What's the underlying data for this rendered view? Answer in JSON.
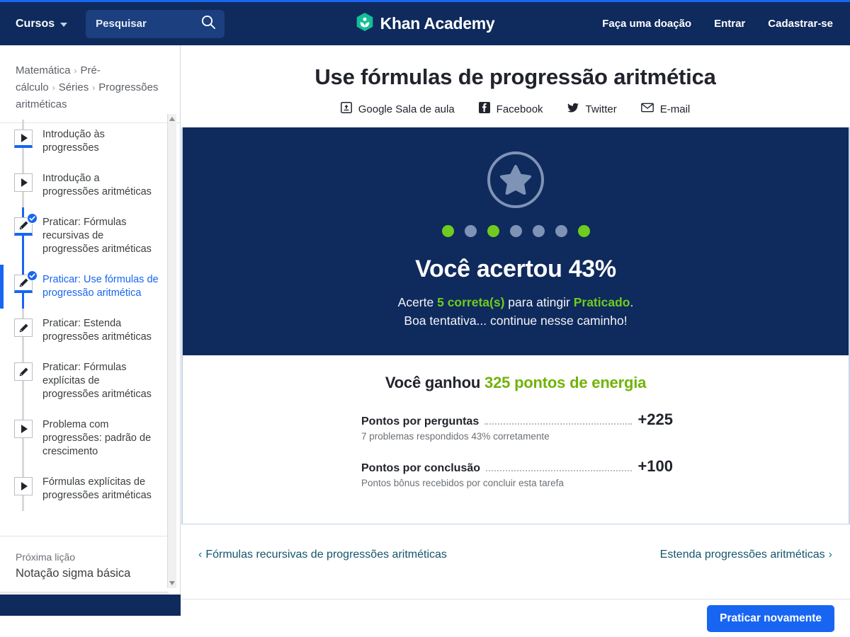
{
  "nav": {
    "courses_label": "Cursos",
    "search_placeholder": "Pesquisar",
    "brand": "Khan Academy",
    "donate": "Faça uma doação",
    "login": "Entrar",
    "signup": "Cadastrar-se"
  },
  "sidebar": {
    "breadcrumbs": [
      "Matemática",
      "Pré-cálculo",
      "Séries",
      "Progressões aritméticas"
    ],
    "lessons": [
      {
        "label": "Introdução às progressões",
        "type": "video",
        "state": "in-progress",
        "completed": false
      },
      {
        "label": "Introdução a progressões aritméticas",
        "type": "video",
        "state": "default",
        "completed": false
      },
      {
        "label": "Praticar: Fórmulas recursivas de progressões aritméticas",
        "type": "exercise",
        "state": "done",
        "completed": true
      },
      {
        "label": "Praticar: Use fórmulas de progressão aritmética",
        "type": "exercise",
        "state": "active",
        "completed": true
      },
      {
        "label": "Praticar: Estenda progressões aritméticas",
        "type": "exercise",
        "state": "default",
        "completed": false
      },
      {
        "label": "Praticar: Fórmulas explícitas de progressões aritméticas",
        "type": "exercise",
        "state": "default",
        "completed": false
      },
      {
        "label": "Problema com progressões: padrão de crescimento",
        "type": "video",
        "state": "default",
        "completed": false
      },
      {
        "label": "Fórmulas explícitas de progressões aritméticas",
        "type": "video",
        "state": "default",
        "completed": false
      }
    ],
    "next_lesson_label": "Próxima lição",
    "next_lesson_title": "Notação sigma básica"
  },
  "main": {
    "title": "Use fórmulas de progressão aritmética",
    "share": [
      {
        "label": "Google Sala de aula",
        "icon": "google-classroom-icon"
      },
      {
        "label": "Facebook",
        "icon": "facebook-icon"
      },
      {
        "label": "Twitter",
        "icon": "twitter-icon"
      },
      {
        "label": "E-mail",
        "icon": "email-icon"
      }
    ],
    "hero": {
      "dots": [
        "green",
        "gray",
        "green",
        "gray",
        "gray",
        "gray",
        "green"
      ],
      "headline": "Você acertou 43%",
      "sub_pre": "Acerte ",
      "sub_correct": "5 correta(s)",
      "sub_mid": " para atingir ",
      "sub_level": "Praticado",
      "sub_post": ".",
      "sub_line2": "Boa tentativa... continue nesse caminho!"
    },
    "points": {
      "heading_pre": "Você ganhou ",
      "heading_highlight": "325 pontos de energia",
      "rows": [
        {
          "label": "Pontos por perguntas",
          "value": "+225",
          "sub": "7 problemas respondidos 43% corretamente"
        },
        {
          "label": "Pontos por conclusão",
          "value": "+100",
          "sub": "Pontos bônus recebidos por concluir esta tarefa"
        }
      ]
    },
    "pager": {
      "prev": "Fórmulas recursivas de progressões aritméticas",
      "next": "Estenda progressões aritméticas",
      "prev_chevron": "‹",
      "next_chevron": "›"
    },
    "practice_again": "Praticar novamente"
  },
  "colors": {
    "nav_blue": "#0f2a5c",
    "accent_blue": "#1865f2",
    "green": "#6fcc1f",
    "points_green": "#71b307",
    "link_teal": "#13566c"
  }
}
